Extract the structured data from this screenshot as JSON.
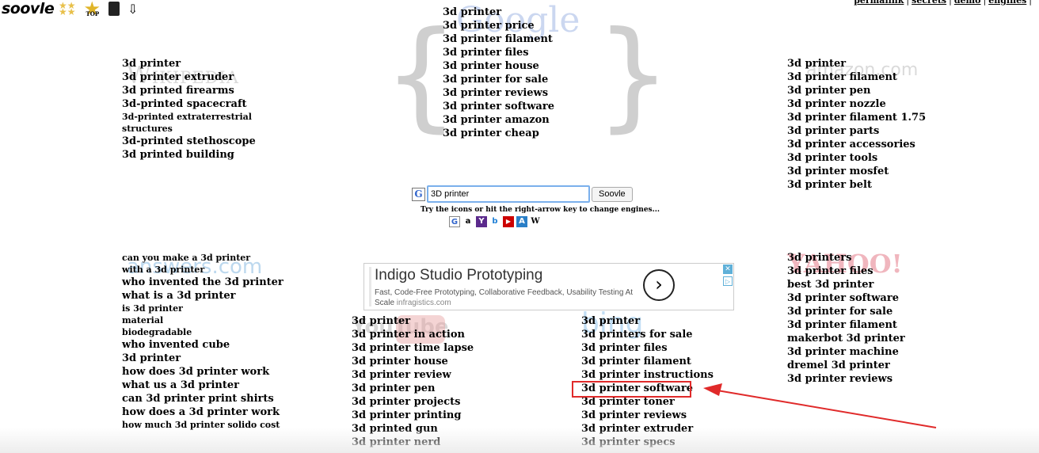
{
  "header": {
    "logo": "soovle",
    "top_badge": "TOP",
    "links": [
      "permalink",
      "secrets",
      "demo",
      "engines"
    ]
  },
  "watermarks": {
    "google": "Google",
    "wikipedia": "Wikipedia",
    "amazon": "amazon.com",
    "answers": "answers.com",
    "youtube": "YouTube",
    "bing": "bing",
    "yahoo": "YAHOO!"
  },
  "google": [
    "3d printer",
    "3d printer price",
    "3d printer filament",
    "3d printer files",
    "3d printer house",
    "3d printer for sale",
    "3d printer reviews",
    "3d printer software",
    "3d printer amazon",
    "3d printer cheap"
  ],
  "wikipedia": [
    "3d printer",
    "3d printer extruder",
    "3d printed firearms",
    "3d-printed spacecraft",
    "3d-printed extraterrestrial structures",
    "3d-printed stethoscope",
    "3d printed building"
  ],
  "amazon": [
    "3d printer",
    "3d printer filament",
    "3d printer pen",
    "3d printer nozzle",
    "3d printer filament 1.75",
    "3d printer parts",
    "3d printer accessories",
    "3d printer tools",
    "3d printer mosfet",
    "3d printer belt"
  ],
  "answers": [
    "can you make a 3d printer with a 3d printer",
    "who invented the 3d printer",
    "what is a 3d printer",
    "is 3d printer material biodegradable",
    "who invented cube 3d printer",
    "how does 3d printer work",
    "what us a 3d printer",
    "can 3d printer print shirts",
    "how does a 3d printer work",
    "how much 3d printer solido cost"
  ],
  "youtube": [
    "3d printer",
    "3d printer in action",
    "3d printer time lapse",
    "3d printer house",
    "3d printer review",
    "3d printer pen",
    "3d printer projects",
    "3d printer printing",
    "3d printed gun",
    "3d printer nerd"
  ],
  "bing": [
    "3d printer",
    "3d printers for sale",
    "3d printer files",
    "3d printer filament",
    "3d printer instructions",
    "3d printer software",
    "3d printer toner",
    "3d printer reviews",
    "3d printer extruder",
    "3d printer specs"
  ],
  "yahoo": [
    "3d printers",
    "3d printer files",
    "best 3d printer",
    "3d printer software",
    "3d printer for sale",
    "3d printer filament",
    "makerbot 3d printer",
    "3d printer machine",
    "dremel 3d printer",
    "3d printer reviews"
  ],
  "search": {
    "engine_letter": "G",
    "value": "3D printer",
    "button": "Soovle",
    "hint": "Try the icons or hit the right-arrow key to change engines..."
  },
  "engine_icons": [
    "G",
    "a",
    "Y",
    "b",
    "▶",
    "A",
    "W"
  ],
  "ad": {
    "title": "Indigo Studio Prototyping",
    "desc": "Fast, Code-Free Prototyping, Collaborative Feedback, Usability Testing At Scale",
    "domain": "infragistics.com",
    "go": "›",
    "close": "✕",
    "adchoices": "▷"
  },
  "colors": {
    "highlight": "#e02a2a",
    "search_border": "#7bb0ec"
  }
}
